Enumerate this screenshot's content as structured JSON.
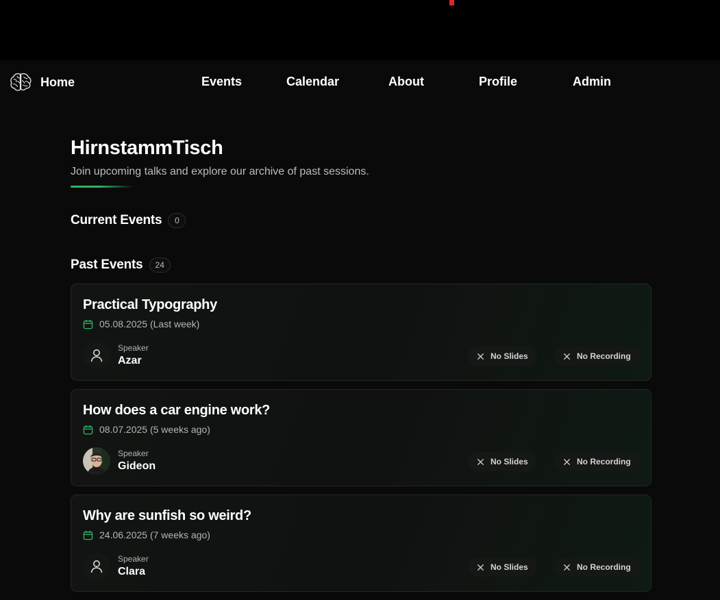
{
  "nav": {
    "home": "Home",
    "links": [
      "Events",
      "Calendar",
      "About",
      "Profile",
      "Admin"
    ]
  },
  "page": {
    "title": "HirnstammTisch",
    "subtitle": "Join upcoming talks and explore our archive of past sessions."
  },
  "current": {
    "title": "Current Events",
    "count": "0"
  },
  "past": {
    "title": "Past Events",
    "count": "24",
    "events": [
      {
        "title": "Practical Typography",
        "date": "05.08.2025 (Last week)",
        "speaker_caption": "Speaker",
        "speaker": "Azar",
        "avatar": "person-icon",
        "slides": "No Slides",
        "recording": "No Recording"
      },
      {
        "title": "How does a car engine work?",
        "date": "08.07.2025 (5 weeks ago)",
        "speaker_caption": "Speaker",
        "speaker": "Gideon",
        "avatar": "photo",
        "slides": "No Slides",
        "recording": "No Recording"
      },
      {
        "title": "Why are sunfish so weird?",
        "date": "24.06.2025 (7 weeks ago)",
        "speaker_caption": "Speaker",
        "speaker": "Clara",
        "avatar": "person-icon",
        "slides": "No Slides",
        "recording": "No Recording"
      }
    ]
  },
  "colors": {
    "background": "#0a0a0a",
    "accent": "#2fb565",
    "top_marker": "#d42a2a"
  }
}
